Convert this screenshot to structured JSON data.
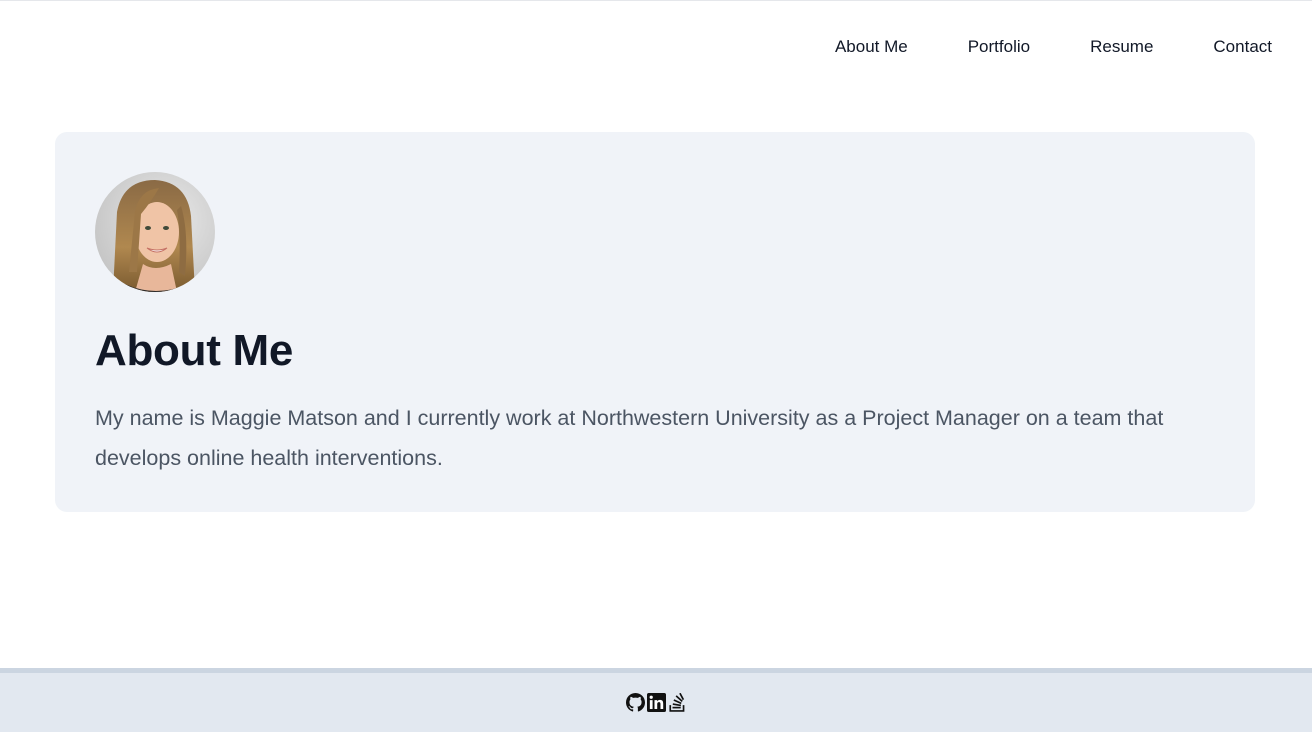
{
  "nav": {
    "items": [
      {
        "label": "About Me"
      },
      {
        "label": "Portfolio"
      },
      {
        "label": "Resume"
      },
      {
        "label": "Contact"
      }
    ]
  },
  "about": {
    "title": "About Me",
    "text": "My name is Maggie Matson and I currently work at Northwestern University as a Project Manager on a team that develops online health interventions."
  },
  "footer": {
    "icons": [
      "github-icon",
      "linkedin-icon",
      "stackoverflow-icon"
    ]
  },
  "colors": {
    "card_bg": "#f0f3f8",
    "footer_bg": "#e2e8f0",
    "text_primary": "#111827",
    "text_secondary": "#4b5563"
  }
}
